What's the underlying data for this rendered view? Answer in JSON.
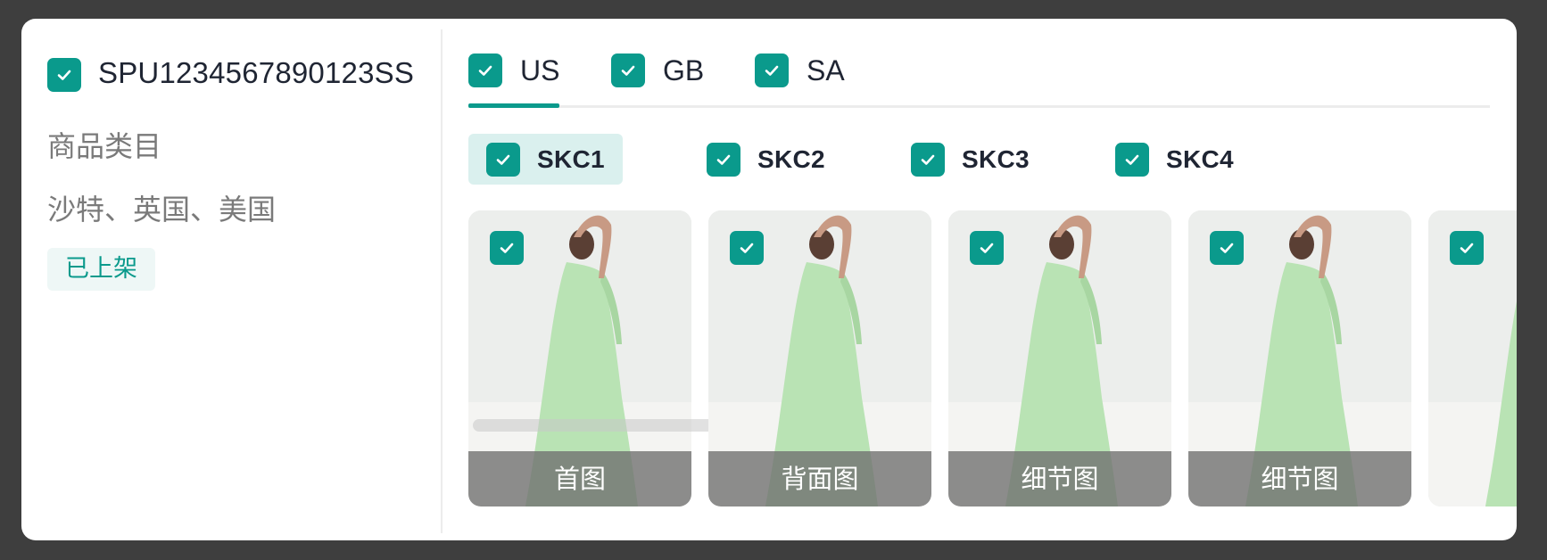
{
  "spu": {
    "code": "SPU1234567890123SS",
    "category": "商品类目",
    "regions": "沙特、英国、美国",
    "status": "已上架"
  },
  "tabs": [
    {
      "label": "US",
      "checked": true,
      "active": true
    },
    {
      "label": "GB",
      "checked": true,
      "active": false
    },
    {
      "label": "SA",
      "checked": true,
      "active": false
    }
  ],
  "skcs": [
    {
      "label": "SKC1",
      "checked": true,
      "selected": true
    },
    {
      "label": "SKC2",
      "checked": true,
      "selected": false
    },
    {
      "label": "SKC3",
      "checked": true,
      "selected": false
    },
    {
      "label": "SKC4",
      "checked": true,
      "selected": false
    }
  ],
  "images": [
    {
      "caption": "首图",
      "checked": true
    },
    {
      "caption": "背面图",
      "checked": true
    },
    {
      "caption": "细节图",
      "checked": true
    },
    {
      "caption": "细节图",
      "checked": true
    },
    {
      "caption": "",
      "checked": true
    }
  ],
  "colors": {
    "accent": "#0a9a8c",
    "accent_light": "#daf0ee",
    "background": "#3e3e3e",
    "card": "#ffffff",
    "text_primary": "#1f2533",
    "text_secondary": "#7a7a7a",
    "dress": "#b9e3b4"
  }
}
